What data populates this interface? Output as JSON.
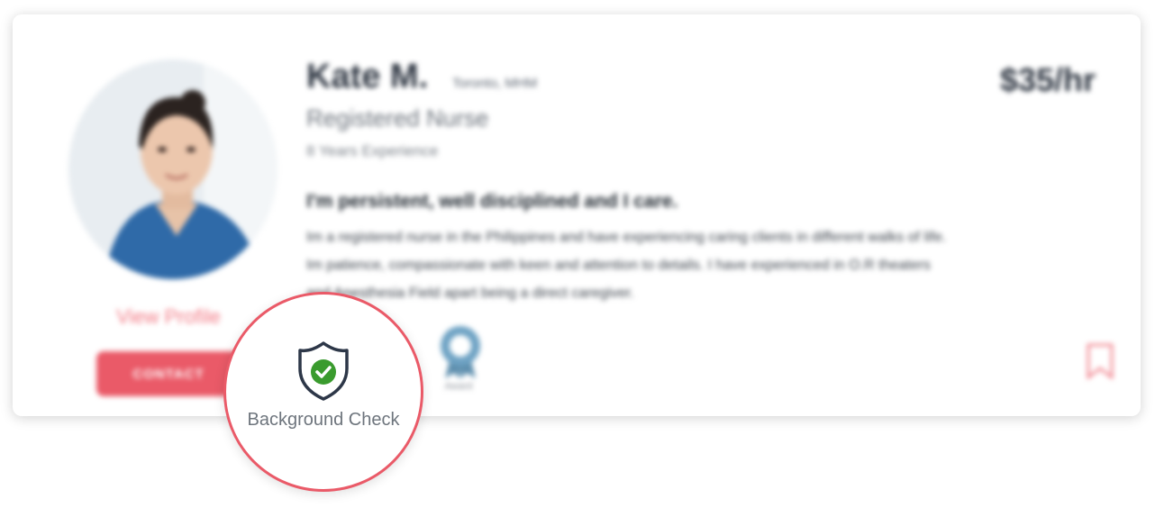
{
  "profile": {
    "name": "Kate M.",
    "location": "Toronto, MHM",
    "title": "Registered Nurse",
    "experience": "8 Years Experience",
    "rate": "$35/hr",
    "headline": "I'm persistent, well disciplined and I care.",
    "bio_lines": [
      "Im a registered nurse in the Philippines and have experiencing caring clients in different walks of life.",
      "Im patience, compassionate with keen and attention to details. I have experienced in O.R theaters",
      "and Anesthesia Field apart being a direct caregiver."
    ],
    "view_profile": "View Profile",
    "contact_label": "CONTACT",
    "award_label": "Award"
  },
  "callout": {
    "label": "Background Check",
    "icon": "shield-check-icon"
  },
  "colors": {
    "accent": "#ea5a68",
    "check_green": "#3a9b2e",
    "shield_dark": "#2d3748"
  }
}
